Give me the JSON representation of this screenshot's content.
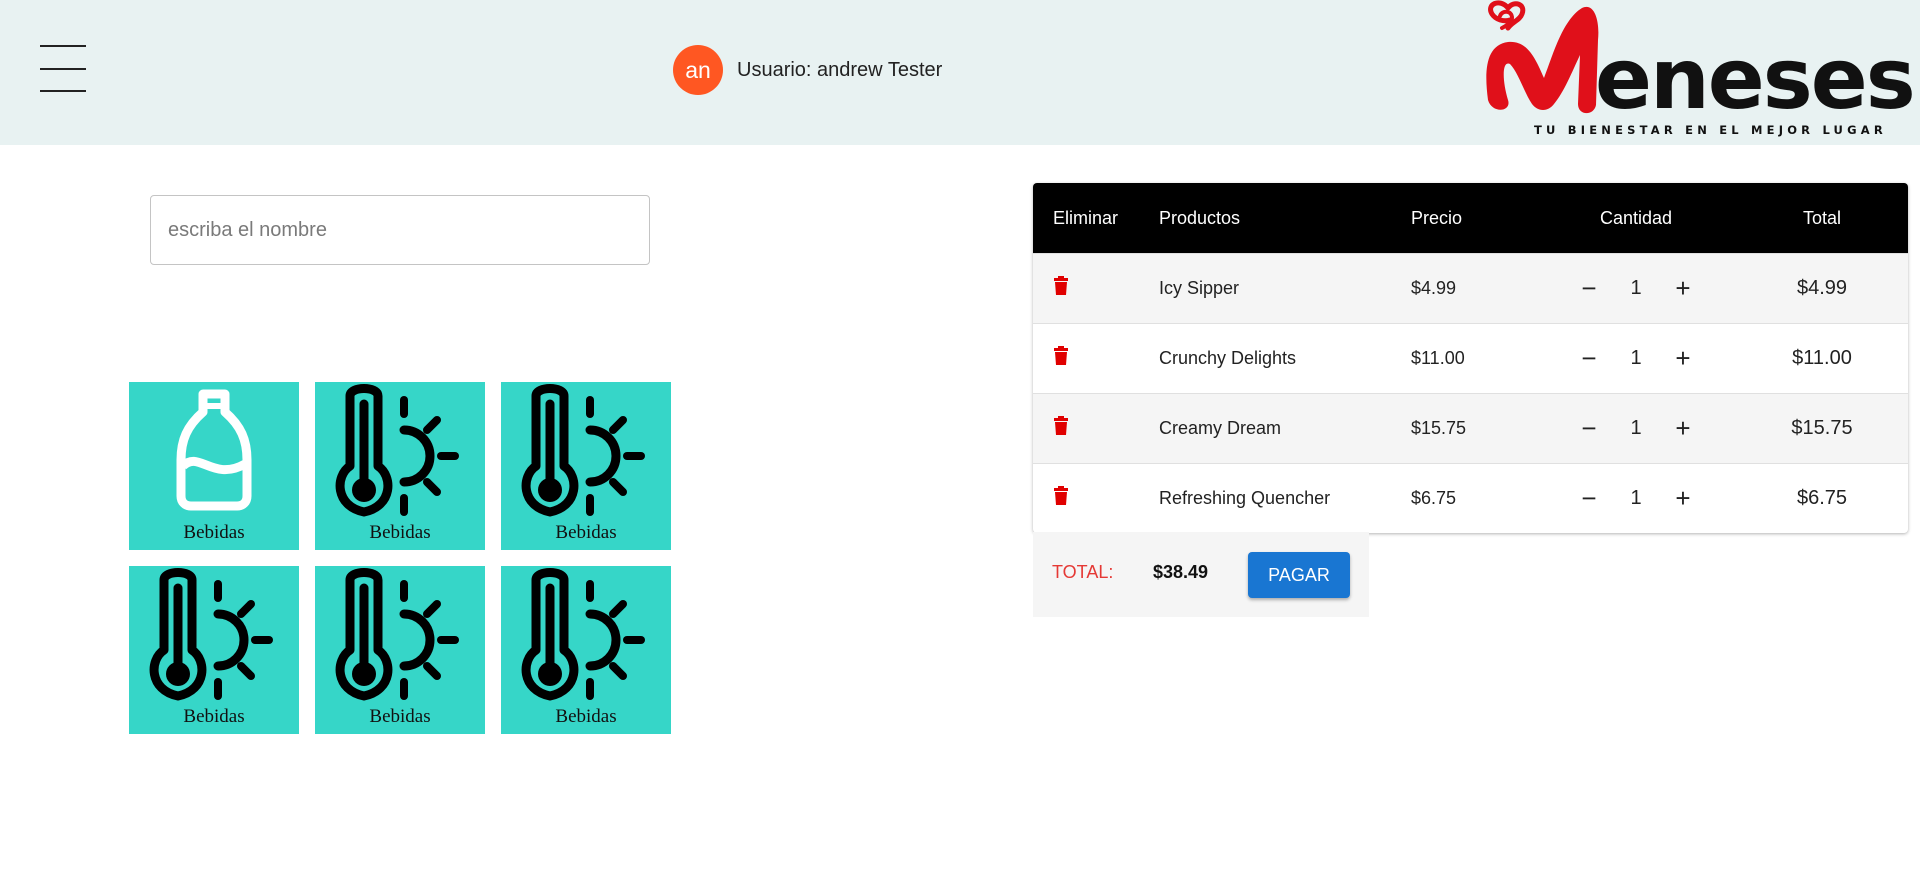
{
  "header": {
    "user": {
      "initials": "an",
      "label": "Usuario: andrew Tester",
      "avatar_color": "#ff5722"
    },
    "logo": {
      "brand": "Meneses",
      "tagline": "TU BIENESTAR EN EL MEJOR LUGAR",
      "brand_color": "#e0101a"
    },
    "background": "#e8f2f2"
  },
  "search": {
    "placeholder": "escriba el nombre",
    "value": ""
  },
  "categories": [
    {
      "label": "Bebidas",
      "icon": "bottle-icon"
    },
    {
      "label": "Bebidas",
      "icon": "thermometer-sun-icon"
    },
    {
      "label": "Bebidas",
      "icon": "thermometer-sun-icon"
    },
    {
      "label": "Bebidas",
      "icon": "thermometer-sun-icon"
    },
    {
      "label": "Bebidas",
      "icon": "thermometer-sun-icon"
    },
    {
      "label": "Bebidas",
      "icon": "thermometer-sun-icon"
    }
  ],
  "cart": {
    "headers": {
      "delete": "Eliminar",
      "product": "Productos",
      "price": "Precio",
      "quantity": "Cantidad",
      "total": "Total"
    },
    "items": [
      {
        "product": "Icy Sipper",
        "price": "$4.99",
        "quantity": "1",
        "total": "$4.99"
      },
      {
        "product": "Crunchy Delights",
        "price": "$11.00",
        "quantity": "1",
        "total": "$11.00"
      },
      {
        "product": "Creamy Dream",
        "price": "$15.75",
        "quantity": "1",
        "total": "$15.75"
      },
      {
        "product": "Refreshing Quencher",
        "price": "$6.75",
        "quantity": "1",
        "total": "$6.75"
      }
    ],
    "decrement_symbol": "−",
    "increment_symbol": "+"
  },
  "summary": {
    "total_label": "TOTAL:",
    "total_value": "$38.49",
    "pay_label": "PAGAR"
  },
  "colors": {
    "tile": "#36d6c8",
    "pay_button": "#1976d2",
    "delete_icon": "#e00000",
    "total_label": "#e53935"
  }
}
